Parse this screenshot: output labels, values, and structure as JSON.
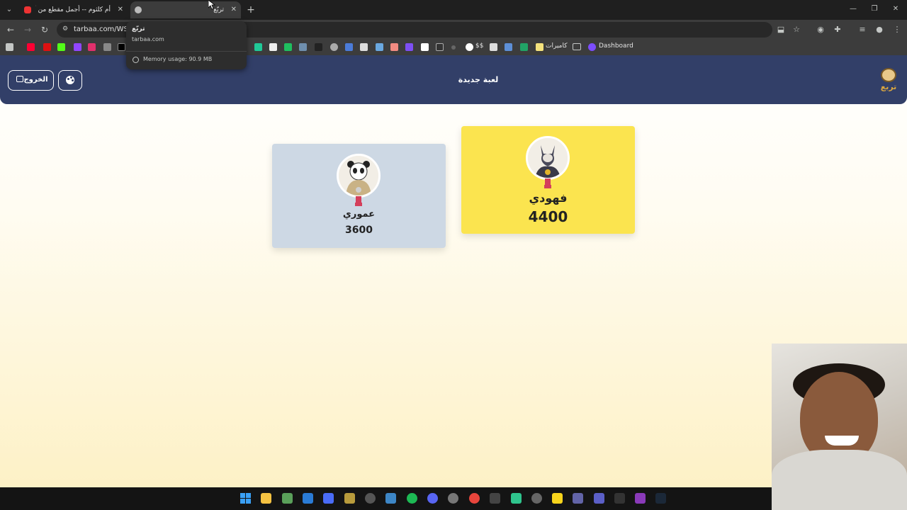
{
  "browser": {
    "tabs": [
      {
        "title": "أم كلثوم -- أجمل مقطع من أغنية",
        "favicon": "youtube-icon",
        "active": false
      },
      {
        "title": "تربّع",
        "favicon": "gear-icon",
        "active": true
      }
    ],
    "address_bar": {
      "url": "tarbaa.com/WSLC"
    },
    "hover_card": {
      "title": "تربّع",
      "domain": "tarbaa.com",
      "memory": "Memory usage: 90.9 MB"
    },
    "bookmarks": [
      {
        "label": "$$"
      },
      {
        "label": "كاميرات"
      },
      {
        "label": "Dashboard"
      }
    ]
  },
  "app": {
    "header": {
      "title": "لعبة جديدة",
      "exit_label": "الخروج",
      "logo_text": "تربع"
    },
    "players": [
      {
        "name": "فهودي",
        "score": "4400",
        "color": "#fbe44f"
      },
      {
        "name": "عموري",
        "score": "3600",
        "color": "#cdd8e4"
      }
    ]
  },
  "colors": {
    "header_bg": "#323f68",
    "winner_card": "#fbe44f",
    "second_card": "#cdd8e4",
    "medal": "#d43f5b"
  }
}
